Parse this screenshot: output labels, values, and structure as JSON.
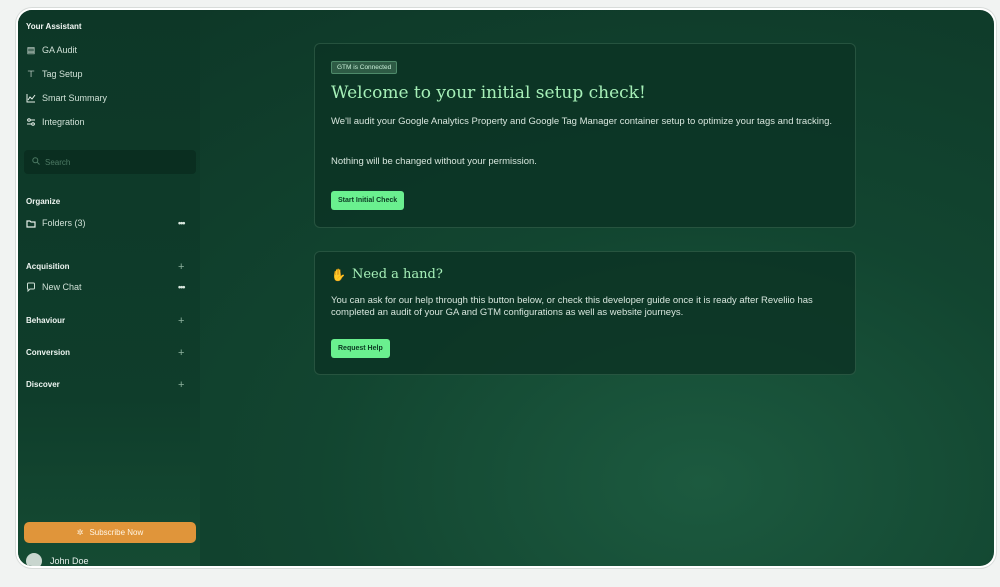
{
  "sidebar": {
    "section_title": "Your Assistant",
    "nav": [
      {
        "label": "GA Audit",
        "icon": "clipboard-icon"
      },
      {
        "label": "Tag Setup",
        "icon": "signpost-icon"
      },
      {
        "label": "Smart Summary",
        "icon": "line-chart-icon"
      },
      {
        "label": "Integration",
        "icon": "sliders-icon"
      }
    ],
    "search_placeholder": "Search",
    "organize": {
      "label": "Organize",
      "folders_label": "Folders (3)"
    },
    "acquisition": {
      "label": "Acquisition",
      "new_chat_label": "New Chat"
    },
    "behaviour": {
      "label": "Behaviour"
    },
    "conversion": {
      "label": "Conversion"
    },
    "discover": {
      "label": "Discover"
    },
    "subscribe_label": "Subscribe Now",
    "user_name": "John Doe"
  },
  "card_setup": {
    "badge": "GTM is Connected",
    "title": "Welcome to your initial setup check!",
    "text1": "We'll audit your Google Analytics Property and Google Tag Manager container setup to optimize your tags and tracking.",
    "text2": "Nothing will be changed without your permission.",
    "button": "Start Initial Check"
  },
  "card_help": {
    "title": "Need a hand?",
    "text": "You can ask for our help through this button below, or check this developer guide once it is ready after Reveliio has completed an audit of your GA and GTM configurations as well as website journeys.",
    "button": "Request Help"
  },
  "colors": {
    "accent_green": "#6af08f",
    "title_green": "#a6f0b8",
    "subscribe_orange": "#e0953a",
    "background": "#0d3526"
  }
}
